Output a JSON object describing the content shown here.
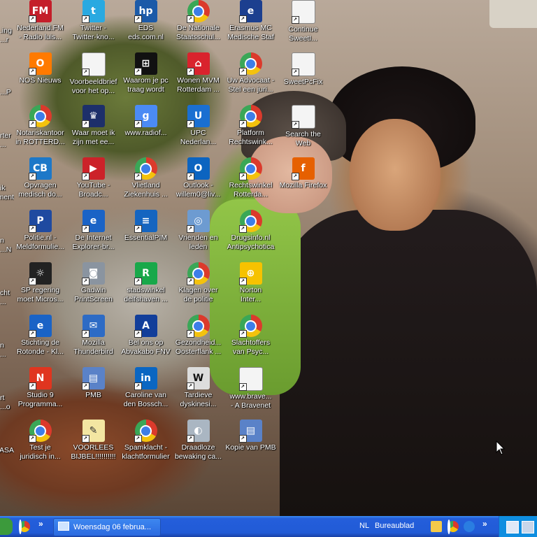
{
  "desktop": {
    "partial_labels": [
      {
        "l1": "ing.",
        "l2": "r..."
      },
      {
        "l1": "",
        "l2": "P..."
      },
      {
        "l1": "rter",
        "l2": "..."
      },
      {
        "l1": "ik",
        "l2": "ment"
      },
      {
        "l1": "n",
        "l2": "N..."
      },
      {
        "l1": "cht",
        "l2": "..."
      },
      {
        "l1": "n",
        "l2": "..."
      },
      {
        "l1": "rt",
        "l2": "o..."
      },
      {
        "l1": "ASA",
        "l2": ""
      }
    ],
    "icons": [
      {
        "icon": "fm-radio-icon",
        "l1": "Nederland.FM",
        "l2": "- Radio luis..."
      },
      {
        "icon": "twitter-icon",
        "l1": "Twitter -",
        "l2": "Twitter-kno..."
      },
      {
        "icon": "hp-icon",
        "l1": "EDS",
        "l2": "eds.com.nl"
      },
      {
        "icon": "chrome-icon",
        "l1": "De Nationale",
        "l2": "Staatsschul..."
      },
      {
        "icon": "erasmus-icon",
        "l1": "Erasmus MC",
        "l2": "Medische Staf"
      },
      {
        "icon": "window-icon",
        "l1": "Continue",
        "l2": "SweetI..."
      },
      {
        "icon": "nos-icon",
        "l1": "NOS Nieuws",
        "l2": ""
      },
      {
        "icon": "document-icon",
        "l1": "Voorbeeldbrief",
        "l2": "voor het op..."
      },
      {
        "icon": "windows-logo-icon",
        "l1": "Waarom je pc",
        "l2": "traag wordt"
      },
      {
        "icon": "house-icon",
        "l1": "Wonen MVM",
        "l2": "Rotterdam ..."
      },
      {
        "icon": "chrome-icon",
        "l1": "Uw Advocaat -",
        "l2": "Stel een juri..."
      },
      {
        "icon": "window-icon",
        "l1": "SweetPcFix",
        "l2": ""
      },
      {
        "icon": "chrome-icon",
        "l1": "Notariskantoor",
        "l2": "in ROTTERD..."
      },
      {
        "icon": "crest-icon",
        "l1": "Waar moet ik",
        "l2": "zijn met ee..."
      },
      {
        "icon": "google-maps-icon",
        "l1": "www.radiof...",
        "l2": ""
      },
      {
        "icon": "upc-icon",
        "l1": "UPC",
        "l2": "Nederlan..."
      },
      {
        "icon": "chrome-icon",
        "l1": "Platform",
        "l2": "Rechtswink..."
      },
      {
        "icon": "window-icon",
        "l1": "Search the",
        "l2": "Web"
      },
      {
        "icon": "cb-icon",
        "l1": "Opvragen",
        "l2": "medisch do..."
      },
      {
        "icon": "youtube-icon",
        "l1": "YouTube -",
        "l2": "Broadc..."
      },
      {
        "icon": "chrome-icon",
        "l1": "Vlietland",
        "l2": "Ziekenhuis ..."
      },
      {
        "icon": "outlook-icon",
        "l1": "Outlook -",
        "l2": "willem0@liv..."
      },
      {
        "icon": "chrome-icon",
        "l1": "Rechtswinkel",
        "l2": "Rotterda..."
      },
      {
        "icon": "firefox-icon",
        "l1": "Mozilla Firefox",
        "l2": ""
      },
      {
        "icon": "politie-icon",
        "l1": "Politie.nl -",
        "l2": "Meldformulie..."
      },
      {
        "icon": "ie-icon",
        "l1": "De Internet",
        "l2": "Explorer-br..."
      },
      {
        "icon": "essentialpim-icon",
        "l1": "EssentialPIM",
        "l2": ""
      },
      {
        "icon": "globe-icon",
        "l1": "Vrienden en",
        "l2": "leden"
      },
      {
        "icon": "chrome-icon",
        "l1": "Drugsinfo.nl",
        "l2": "Antipsychotica"
      },
      {
        "icon": "",
        "l1": "",
        "l2": ""
      },
      {
        "icon": "sp-icon",
        "l1": "SP regering",
        "l2": "moet Micros..."
      },
      {
        "icon": "camera-icon",
        "l1": "Gadwin",
        "l2": "PrintScreen"
      },
      {
        "icon": "r-icon",
        "l1": "stadswinkel",
        "l2": "delfshaven ..."
      },
      {
        "icon": "chrome-icon",
        "l1": "Klagen over",
        "l2": "de politie"
      },
      {
        "icon": "norton-icon",
        "l1": "Norton",
        "l2": "Inter..."
      },
      {
        "icon": "",
        "l1": "",
        "l2": ""
      },
      {
        "icon": "ie-icon",
        "l1": "Stichting de",
        "l2": "Rotonde - Kl..."
      },
      {
        "icon": "thunderbird-icon",
        "l1": "Mozilla",
        "l2": "Thunderbird"
      },
      {
        "icon": "abvakabo-icon",
        "l1": "Bel ons op",
        "l2": "Abvakabo FNV"
      },
      {
        "icon": "chrome-icon",
        "l1": "Gezondheid...",
        "l2": "Oosterflank ..."
      },
      {
        "icon": "chrome-icon",
        "l1": "Slachtoffers",
        "l2": "van Psyc..."
      },
      {
        "icon": "",
        "l1": "",
        "l2": ""
      },
      {
        "icon": "studio9-icon",
        "l1": "Studio 9",
        "l2": "Programma..."
      },
      {
        "icon": "pmb-icon",
        "l1": "PMB",
        "l2": ""
      },
      {
        "icon": "linkedin-icon",
        "l1": "Caroline van",
        "l2": "den Bossch..."
      },
      {
        "icon": "wikipedia-icon",
        "l1": "Tardieve",
        "l2": "dyskinesi..."
      },
      {
        "icon": "document-icon",
        "l1": "www.brave...",
        "l2": "- A Bravenet"
      },
      {
        "icon": "",
        "l1": "",
        "l2": ""
      },
      {
        "icon": "chrome-icon",
        "l1": "Test je",
        "l2": "juridisch in..."
      },
      {
        "icon": "notepad-icon",
        "l1": "VOORLEES",
        "l2": "BIJBEL!!!!!!!!!!"
      },
      {
        "icon": "chrome-icon",
        "l1": "Spamklacht -",
        "l2": "klachtformulier"
      },
      {
        "icon": "drive-icon",
        "l1": "Draadloze",
        "l2": "bewaking ca..."
      },
      {
        "icon": "pmb-icon",
        "l1": "Kopie van PMB",
        "l2": ""
      }
    ]
  },
  "taskbar": {
    "task_label": "Woensdag 06 februa...",
    "language": "NL",
    "toolbar_label": "Bureaublad",
    "chevron": "»"
  },
  "colors": {
    "taskbar": "#245edb",
    "tray": "#0f8ee0",
    "label": "#ffffff"
  }
}
